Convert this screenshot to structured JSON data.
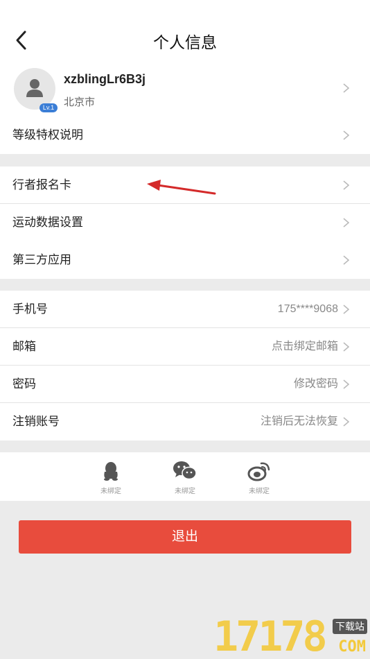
{
  "header": {
    "title": "个人信息"
  },
  "profile": {
    "username": "xzblingLr6B3j",
    "city": "北京市",
    "level": "Lv.1"
  },
  "rows": {
    "level_privileges": {
      "label": "等级特权说明"
    },
    "signup_card": {
      "label": "行者报名卡"
    },
    "sport_data": {
      "label": "运动数据设置"
    },
    "third_party": {
      "label": "第三方应用"
    },
    "phone": {
      "label": "手机号",
      "value": "175****9068"
    },
    "email": {
      "label": "邮箱",
      "value": "点击绑定邮箱"
    },
    "password": {
      "label": "密码",
      "value": "修改密码"
    },
    "deactivate": {
      "label": "注销账号",
      "value": "注销后无法恢复"
    }
  },
  "social": [
    {
      "icon": "qq-icon",
      "label": "未绑定"
    },
    {
      "icon": "wechat-icon",
      "label": "未绑定"
    },
    {
      "icon": "weibo-icon",
      "label": "未绑定"
    }
  ],
  "logout_label": "退出",
  "watermark": {
    "digits": "17178",
    "tag": "下载站",
    "suffix": "COM"
  },
  "colors": {
    "accent": "#e84c3d",
    "level_badge": "#3b7ed6",
    "background": "#ebebeb"
  }
}
